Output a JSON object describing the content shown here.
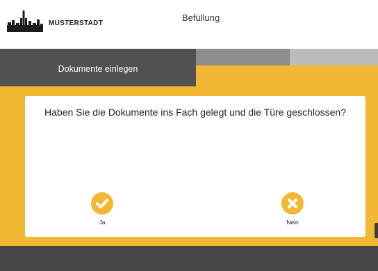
{
  "header": {
    "brand": "MUSTERSTADT",
    "title": "Befüllung"
  },
  "steps": {
    "active_label": "Dokumente einlegen",
    "total": 3,
    "current": 1
  },
  "dialog": {
    "question": "Haben Sie die Dokumente ins Fach gelegt und die Türe geschlossen?",
    "yes_label": "Ja",
    "no_label": "Nein"
  },
  "colors": {
    "accent": "#f3b833",
    "active_tab": "#515151",
    "step_2": "#8e8e8e",
    "step_3": "#bcbcbc",
    "footer": "#474747"
  },
  "icons": {
    "logo": "city-skyline-icon",
    "yes": "check-circle-icon",
    "no": "x-circle-icon"
  }
}
